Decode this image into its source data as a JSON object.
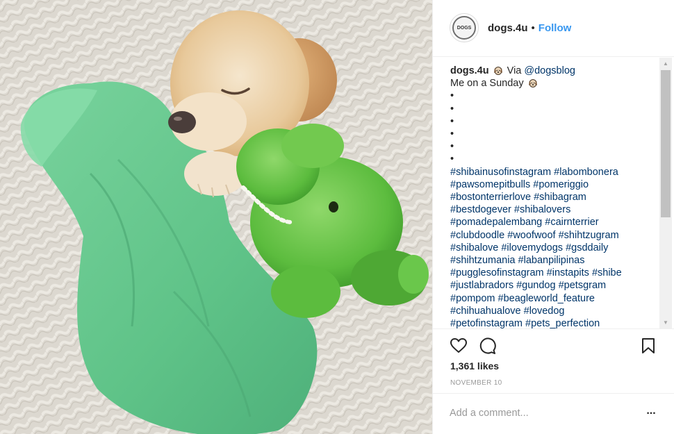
{
  "header": {
    "avatar_text": "DOGS",
    "username": "dogs.4u",
    "separator": "•",
    "follow_label": "Follow"
  },
  "caption": {
    "username": "dogs.4u",
    "via_text": "Via",
    "mention": "@dogsblog",
    "line2": "Me on a Sunday",
    "bullet": "•",
    "hashtag_lines": [
      [
        "#shibainusofinstagram",
        "#labombonera"
      ],
      [
        "#pawsomepitbulls",
        "#pomeriggio"
      ],
      [
        "#bostonterrierlove",
        "#shibagram"
      ],
      [
        "#bestdogever",
        "#shibalovers"
      ],
      [
        "#pomadepalembang",
        "#cairnterrier"
      ],
      [
        "#clubdoodle",
        "#woofwoof",
        "#shihtzugram"
      ],
      [
        "#shibalove",
        "#ilovemydogs",
        "#gsddaily"
      ],
      [
        "#shihtzumania",
        "#labanpilipinas"
      ],
      [
        "#pugglesofinstagram",
        "#instapits",
        "#shibe"
      ],
      [
        "#justlabradors",
        "#gundog",
        "#petsgram"
      ],
      [
        "#pompom",
        "#beagleworld_feature"
      ],
      [
        "#chihuahualove",
        "#lovedog"
      ],
      [
        "#petofinstagram",
        "#pets_perfection"
      ]
    ]
  },
  "actions": {
    "icons": [
      "heart-icon",
      "comment-icon",
      "bookmark-icon"
    ]
  },
  "likes": "1,361 likes",
  "date": "NOVEMBER 10",
  "comment": {
    "placeholder": "Add a comment...",
    "more_label": "..."
  },
  "colors": {
    "link": "#003569",
    "follow": "#3897f0",
    "text": "#262626",
    "muted": "#999999"
  }
}
